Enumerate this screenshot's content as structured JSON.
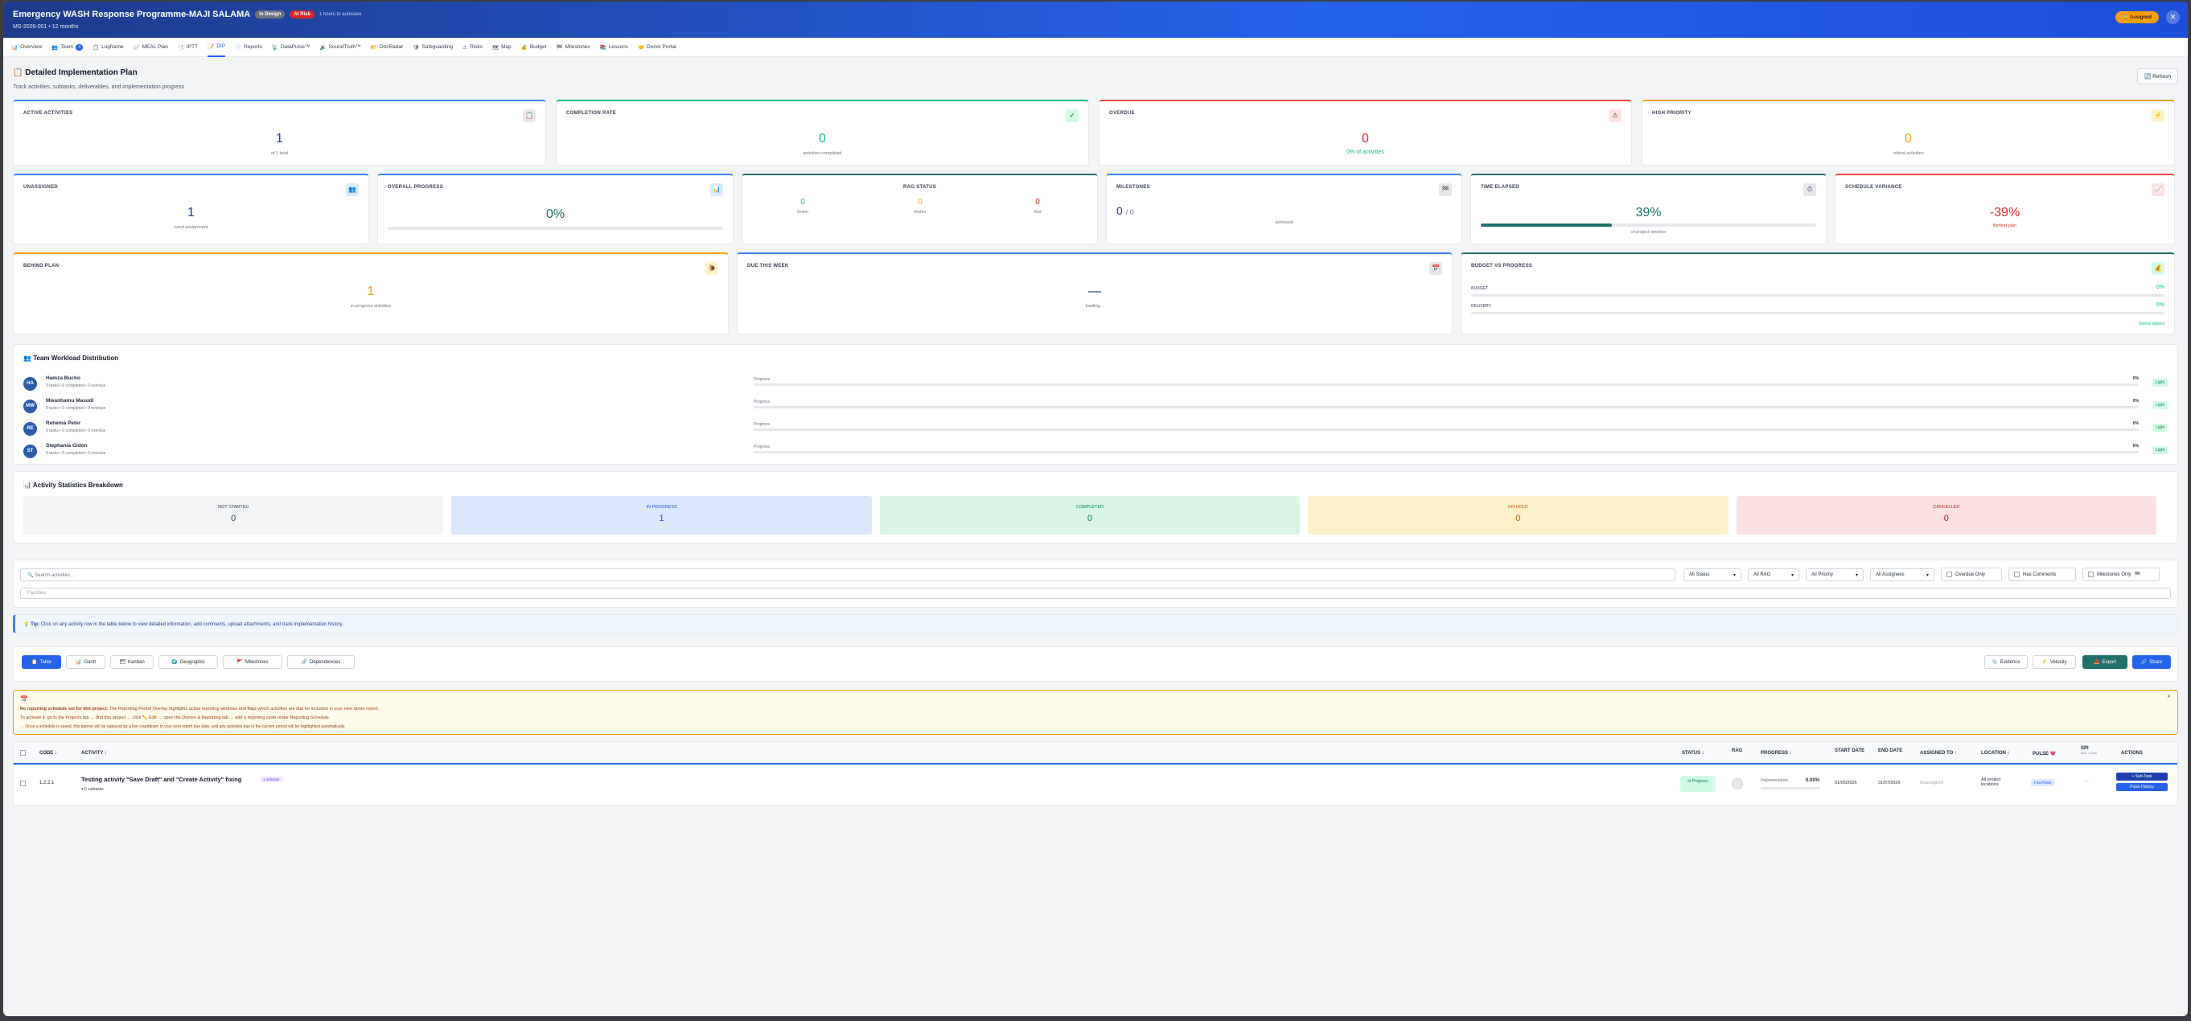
{
  "header": {
    "title": "Emergency WASH Response Programme-MAJI SALAMA",
    "status_pill": "In Design",
    "alert_pill": "At Risk",
    "saved_text": "1 hours to autosave",
    "subtitle": "MS-2026-001 • 12 months",
    "assign_button": "Assigned"
  },
  "tabs": [
    {
      "label": "Overview"
    },
    {
      "label": "Team",
      "badge": "4"
    },
    {
      "label": "Logframe"
    },
    {
      "label": "MEAL Plan"
    },
    {
      "label": "IPTT"
    },
    {
      "label": "DIP"
    },
    {
      "label": "Reports"
    },
    {
      "label": "DataPulse™"
    },
    {
      "label": "SoundTruth™"
    },
    {
      "label": "DocRadar"
    },
    {
      "label": "Safeguarding"
    },
    {
      "label": "Risks"
    },
    {
      "label": "Map"
    },
    {
      "label": "Budget"
    },
    {
      "label": "Milestones"
    },
    {
      "label": "Lessons"
    },
    {
      "label": "Donor Portal"
    }
  ],
  "page": {
    "title": "Detailed Implementation Plan",
    "subtitle": "Track activities, subtasks, deliverables, and implementation progress",
    "refresh": "Refresh"
  },
  "cards": {
    "active": {
      "label": "ACTIVE ACTIVITIES",
      "value": "1",
      "sub": "of 1 total"
    },
    "completion": {
      "label": "COMPLETION RATE",
      "value": "0",
      "sub": "activities completed"
    },
    "overdue": {
      "label": "OVERDUE",
      "value": "0",
      "sub": "0% of activities"
    },
    "high": {
      "label": "HIGH PRIORITY",
      "value": "0",
      "sub": "critical activities"
    },
    "unassigned": {
      "label": "UNASSIGNED",
      "value": "1",
      "sub": "need assignment"
    },
    "overall": {
      "label": "OVERALL PROGRESS",
      "value": "0%"
    },
    "rag": {
      "label": "RAG STATUS",
      "green": "0",
      "green_l": "Green",
      "amber": "0",
      "amber_l": "Amber",
      "red": "0",
      "red_l": "Red"
    },
    "milestones": {
      "label": "MILESTONES",
      "value": "0",
      "of": "/ 0",
      "sub": "achieved"
    },
    "elapsed": {
      "label": "TIME ELAPSED",
      "value": "39%",
      "sub": "of project timeline",
      "progress": 0.39
    },
    "variance": {
      "label": "SCHEDULE VARIANCE",
      "value": "-39%",
      "sub": "Behind plan"
    },
    "behind": {
      "label": "BEHIND PLAN",
      "value": "1",
      "sub": "in-progress activities"
    },
    "due": {
      "label": "DUE THIS WEEK",
      "value": "—",
      "sub": "loading..."
    },
    "budget": {
      "label": "BUDGET VS PROGRESS",
      "budget_l": "BUDGET",
      "budget_v": "0%",
      "delivery_l": "DELIVERY",
      "delivery_v": "0%",
      "note": "Spend aligned"
    }
  },
  "workload": {
    "title": "Team Workload Distribution",
    "members": [
      {
        "initials": "HA",
        "name": "Hamza Bucho",
        "stats": "0 tasks  •  0 completed  •  0 overdue",
        "prog": "Progress",
        "pct": "0%",
        "load": "Light"
      },
      {
        "initials": "MW",
        "name": "Mwanhamu Masudi",
        "stats": "0 tasks  •  0 completed  •  0 overdue",
        "prog": "Progress",
        "pct": "0%",
        "load": "Light"
      },
      {
        "initials": "RE",
        "name": "Rehema Peter",
        "stats": "0 tasks  •  0 completed  •  0 overdue",
        "prog": "Progress",
        "pct": "0%",
        "load": "Light"
      },
      {
        "initials": "ST",
        "name": "Stephania Gidon",
        "stats": "0 tasks  •  0 completed  •  0 overdue",
        "prog": "Progress",
        "pct": "0%",
        "load": "Light"
      }
    ]
  },
  "stats": {
    "title": "Activity Statistics Breakdown",
    "items": [
      {
        "t": "NOT STARTED",
        "v": "0",
        "bg": "#f3f4f6",
        "c": "#374151"
      },
      {
        "t": "IN PROGRESS",
        "v": "1",
        "bg": "#dbe7fb",
        "c": "#1d4ed8"
      },
      {
        "t": "COMPLETED",
        "v": "0",
        "bg": "#d9f5e6",
        "c": "#047857"
      },
      {
        "t": "ON HOLD",
        "v": "0",
        "bg": "#fbf0c9",
        "c": "#b45309"
      },
      {
        "t": "CANCELLED",
        "v": "0",
        "bg": "#fbe1e1",
        "c": "#b91c1c"
      }
    ]
  },
  "filters": {
    "search_placeholder": "🔍 Search activities...",
    "status": "All Status",
    "rag": "All RAG",
    "priority": "All Priority",
    "assignee": "All Assignees",
    "overdue": "Overdue Only",
    "comments": "Has Comments",
    "milestones": "Milestones Only",
    "facilities": "Facilities"
  },
  "tip": {
    "strong": "Tip:",
    "text": "Click on any activity row in the table below to view detailed information, add comments, upload attachments, and track implementation history."
  },
  "views": {
    "buttons": [
      "Table",
      "Gantt",
      "Kanban",
      "Geographic",
      "Milestones",
      "Dependencies"
    ],
    "evidence": "Evidence",
    "velocity": "Velocity",
    "export": "Export",
    "share": "Share"
  },
  "notice": {
    "line1_strong": "No reporting schedule set for this project.",
    "line1": " The Reporting Period Overlay highlights active reporting windows and flags which activities are due for inclusion in your next donor report.",
    "line2": "To activate it: go to the Projects tab → find this project → click ✏️ Edit → open the Donors & Reporting tab → add a reporting cycle under Reporting Schedule.",
    "line3": "→ Once a schedule is saved, this banner will be replaced by a live countdown to your next report due date, and any activities due in the current period will be highlighted automatically."
  },
  "table": {
    "headers": {
      "code": "CODE",
      "activity": "ACTIVITY",
      "status": "STATUS",
      "rag": "RAG",
      "progress": "PROGRESS",
      "start": "START DATE",
      "end": "END DATE",
      "assigned": "ASSIGNED TO",
      "location": "LOCATION",
      "pulse": "PULSE",
      "spi": "SPI",
      "spi_sub": "Sch. / Cost",
      "actions": "ACTIONS"
    },
    "rows": [
      {
        "code": "1.2.2.1",
        "activity": "Testing activity \"Save Draft\" and \"Create Activity\" fixing",
        "tag": "1 indicator",
        "subtasks": "▾ 0 subtasks",
        "status": "In Progress",
        "progress_label": "Implementation",
        "progress": "0.00%",
        "start": "01/05/2026",
        "end": "31/07/2026",
        "assigned": "Unassigned",
        "location": "All project locations",
        "pulse": "First Pulse",
        "spi": "—",
        "sub_task": "+ Sub-Task",
        "history": "Pulse History"
      }
    ]
  }
}
